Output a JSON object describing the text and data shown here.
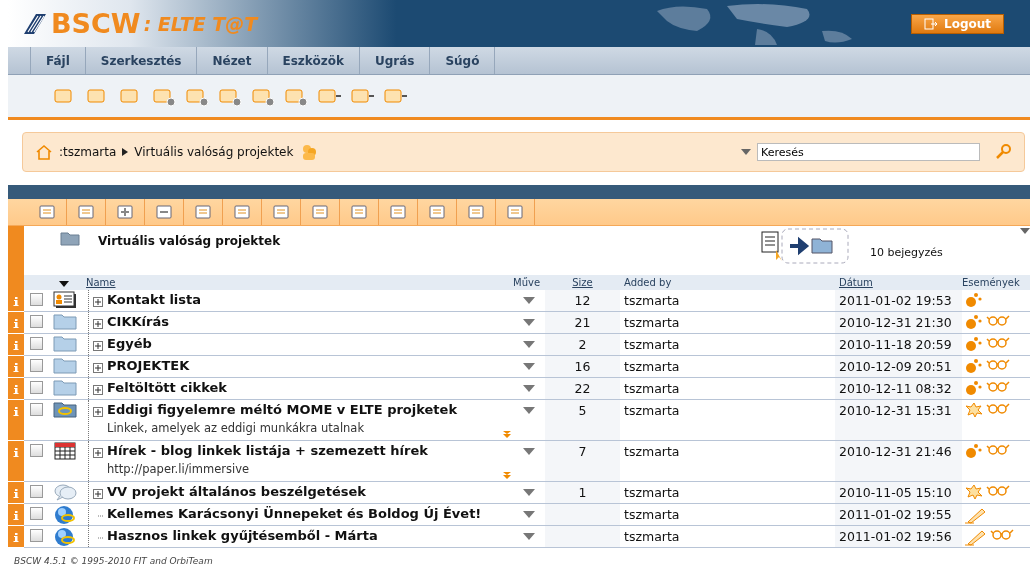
{
  "logo": {
    "name": "BSCW",
    "suffix": ": ELTE T@T"
  },
  "logout": "Logout",
  "menu": [
    {
      "label": "Fájl"
    },
    {
      "label": "Szerkesztés"
    },
    {
      "label": "Nézet"
    },
    {
      "label": "Eszközök"
    },
    {
      "label": "Ugrás"
    },
    {
      "label": "Súgó"
    }
  ],
  "breadcrumb": {
    "items": [
      ":tszmarta",
      "Virtuális valóság projektek"
    ]
  },
  "search": {
    "value": "Keresés"
  },
  "folder": {
    "title": "Virtuális valóság projektek",
    "count": "10 bejegyzés"
  },
  "table": {
    "columns": [
      {
        "label": "Name",
        "sortable": true
      },
      {
        "label": "Műve",
        "sortable": false
      },
      {
        "label": "Size",
        "sortable": true
      },
      {
        "label": "Added by",
        "sortable": false
      },
      {
        "label": "Dátum",
        "sortable": true
      },
      {
        "label": "Események",
        "sortable": false
      }
    ],
    "rows": [
      {
        "kind": "contacts",
        "name": "Kontakt lista",
        "expandable": true,
        "checked": false,
        "size": "12",
        "added_by": "tszmarta",
        "date": "2011-01-02 19:53",
        "events": [
          {
            "kind": "new"
          }
        ]
      },
      {
        "kind": "folder",
        "name": "CIKKírás",
        "expandable": true,
        "checked": false,
        "size": "21",
        "added_by": "tszmarta",
        "date": "2010-12-31 21:30",
        "events": [
          {
            "kind": "new"
          },
          {
            "kind": "read"
          }
        ]
      },
      {
        "kind": "folder",
        "name": "Egyéb",
        "expandable": true,
        "checked": false,
        "size": "2",
        "added_by": "tszmarta",
        "date": "2010-11-18 20:59",
        "events": [
          {
            "kind": "new"
          },
          {
            "kind": "read"
          }
        ]
      },
      {
        "kind": "folder",
        "name": "PROJEKTEK",
        "expandable": true,
        "checked": false,
        "size": "16",
        "added_by": "tszmarta",
        "date": "2010-12-09 20:51",
        "events": [
          {
            "kind": "new"
          },
          {
            "kind": "read"
          }
        ]
      },
      {
        "kind": "folder",
        "name": "Feltöltött cikkek",
        "expandable": true,
        "checked": false,
        "size": "22",
        "added_by": "tszmarta",
        "date": "2010-12-11 08:32",
        "events": [
          {
            "kind": "new"
          },
          {
            "kind": "read"
          }
        ]
      },
      {
        "kind": "linkfolder",
        "name": "Eddigi figyelemre méltó MOME v ELTE projketek",
        "description": "Linkek, amelyek az eddigi munkákra utalnak",
        "expandable": true,
        "checked": false,
        "size": "5",
        "added_by": "tszmarta",
        "date": "2010-12-31 15:31",
        "events": [
          {
            "kind": "changed"
          },
          {
            "kind": "read"
          }
        ]
      },
      {
        "kind": "table",
        "name": "Hírek - blog linkek listája + szemezett hírek",
        "description": "http://paper.li/immersive",
        "expandable": true,
        "checked": false,
        "size": "7",
        "added_by": "tszmarta",
        "date": "2010-12-31 21:46",
        "events": [
          {
            "kind": "new"
          },
          {
            "kind": "read"
          }
        ]
      },
      {
        "kind": "discussion",
        "name": "VV projekt általános beszélgetések",
        "expandable": true,
        "checked": false,
        "size": "1",
        "added_by": "tszmarta",
        "date": "2010-11-05 15:10",
        "events": [
          {
            "kind": "changed"
          },
          {
            "kind": "read"
          }
        ]
      },
      {
        "kind": "url",
        "name": "Kellemes Karácsonyi Ünnepeket és Boldog Új Évet!",
        "expandable": false,
        "checked": false,
        "added_by": "tszmarta",
        "date": "2011-01-02 19:55",
        "events": [
          {
            "kind": "edit"
          }
        ]
      },
      {
        "kind": "url",
        "name": "Hasznos linkek gyűjtésemből - Márta",
        "expandable": false,
        "checked": false,
        "added_by": "tszmarta",
        "date": "2011-01-02 19:56",
        "events": [
          {
            "kind": "edit"
          },
          {
            "kind": "read"
          }
        ]
      }
    ]
  },
  "footer": "BSCW 4.5.1 © 1995-2010 FIT and OrbiTeam"
}
